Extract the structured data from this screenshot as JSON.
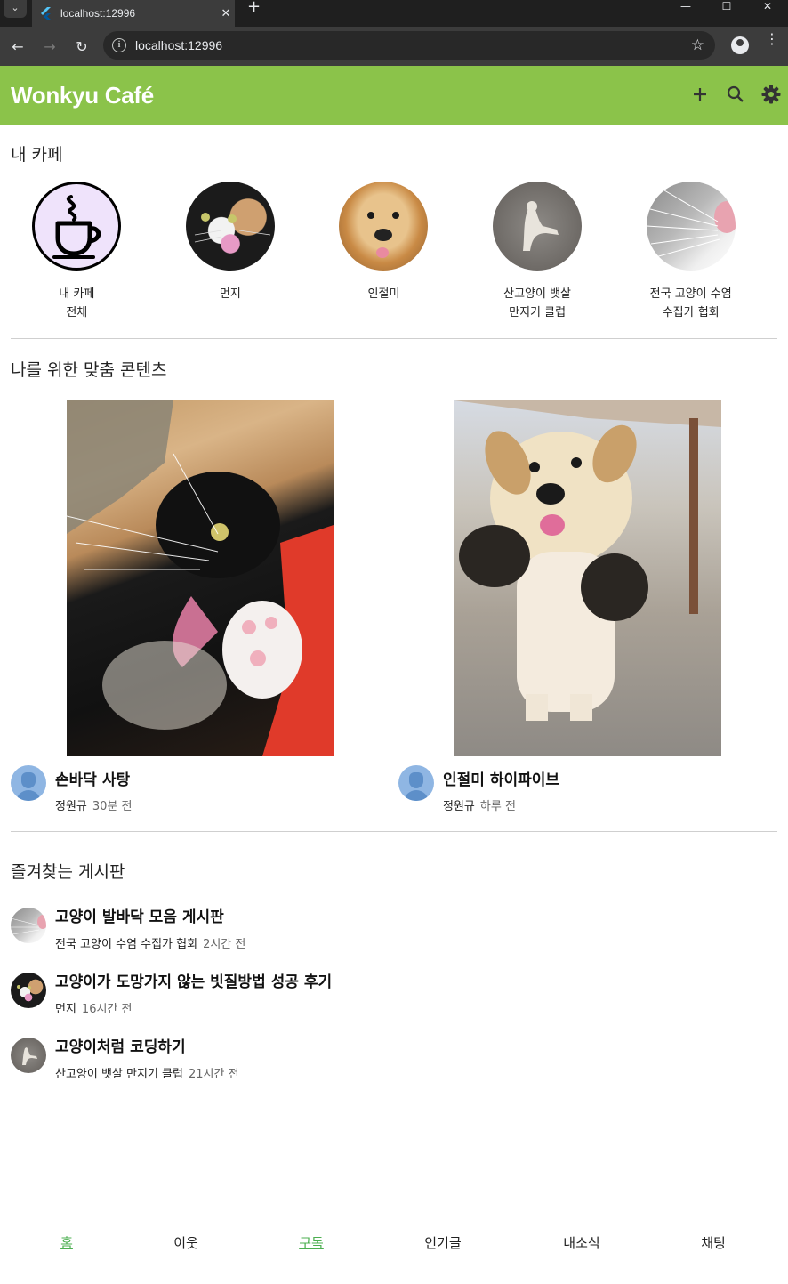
{
  "browser": {
    "tab_title": "localhost:12996",
    "url": "localhost:12996",
    "tab_menu_icon": "chevron-down-icon",
    "new_tab_icon": "plus-icon"
  },
  "appbar": {
    "title": "Wonkyu Café",
    "color": "#8bc34a",
    "actions": [
      "add-icon",
      "search-icon",
      "settings-icon"
    ]
  },
  "my_cafes": {
    "title": "내 카페",
    "items": [
      {
        "label_line1": "내 카페",
        "label_line2": "전체",
        "icon": "coffee-cup-icon"
      },
      {
        "label_line1": "먼지",
        "label_line2": "",
        "icon": "cat-photo"
      },
      {
        "label_line1": "인절미",
        "label_line2": "",
        "icon": "dog-photo"
      },
      {
        "label_line1": "산고양이 뱃살",
        "label_line2": "만지기 클럽",
        "icon": "cat-on-gravel-photo"
      },
      {
        "label_line1": "전국 고양이 수염",
        "label_line2": "수집가 협회",
        "icon": "cat-whiskers-photo"
      }
    ]
  },
  "recommended": {
    "title": "나를 위한 맞춤 콘텐츠",
    "items": [
      {
        "title": "손바닥 사탕",
        "author": "정원규",
        "time": "30분 전"
      },
      {
        "title": "인절미 하이파이브",
        "author": "정원규",
        "time": "하루 전"
      }
    ]
  },
  "favorite_boards": {
    "title": "즐겨찾는 게시판",
    "items": [
      {
        "title": "고양이 발바닥 모음 게시판",
        "cafe": "전국 고양이 수염 수집가 협회",
        "time": "2시간 전"
      },
      {
        "title": "고양이가 도망가지 않는 빗질방법 성공 후기",
        "cafe": "먼지",
        "time": "16시간 전"
      },
      {
        "title": "고양이처럼 코딩하기",
        "cafe": "산고양이 뱃살 만지기 클럽",
        "time": "21시간 전"
      }
    ]
  },
  "bottom_nav": {
    "items": [
      {
        "label": "홈",
        "active": true
      },
      {
        "label": "이웃",
        "active": false
      },
      {
        "label": "구독",
        "active": true
      },
      {
        "label": "인기글",
        "active": false
      },
      {
        "label": "내소식",
        "active": false
      },
      {
        "label": "채팅",
        "active": false
      }
    ],
    "active_color": "#4caf50"
  }
}
